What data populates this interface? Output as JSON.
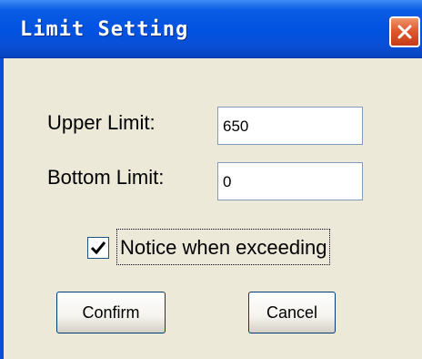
{
  "window": {
    "title": "Limit Setting",
    "close_icon": "close-icon"
  },
  "form": {
    "upper_limit_label": "Upper  Limit:",
    "upper_limit_value": "650",
    "bottom_limit_label": "Bottom Limit:",
    "bottom_limit_value": "0",
    "notice_checked": true,
    "notice_label": "Notice when exceeding"
  },
  "buttons": {
    "confirm": "Confirm",
    "cancel": "Cancel"
  },
  "colors": {
    "titlebar": "#0052E0",
    "dialog_bg": "#ECE9D8",
    "close_button": "#E05A2E"
  }
}
